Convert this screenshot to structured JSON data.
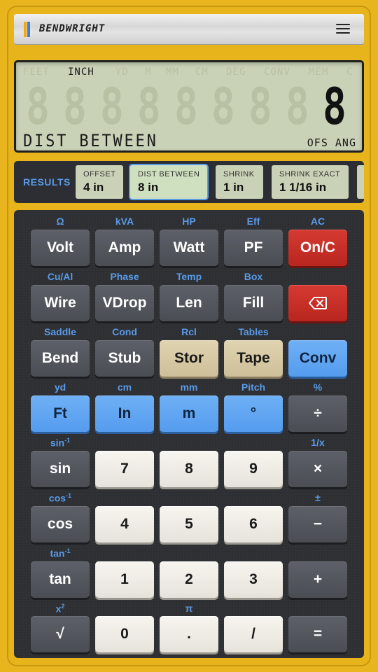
{
  "brand": {
    "name": "BENDWRIGHT",
    "menu_icon": "hamburger-menu-icon"
  },
  "lcd": {
    "annunciators": [
      {
        "label": "FEET",
        "on": false
      },
      {
        "label": "INCH",
        "on": true
      },
      {
        "label": "YD",
        "on": false
      },
      {
        "label": "M",
        "on": false
      },
      {
        "label": "MM",
        "on": false
      },
      {
        "label": "CM",
        "on": false
      },
      {
        "label": "DEG",
        "on": false
      },
      {
        "label": "CONV",
        "on": false
      },
      {
        "label": "MEM",
        "on": false
      },
      {
        "label": "C",
        "on": false
      }
    ],
    "ghost_digits": [
      "8",
      "8",
      "8",
      "8",
      "8",
      "8",
      "8",
      "8",
      "8"
    ],
    "value": "8",
    "label": "DIST BETWEEN",
    "mode": "OFS ANG"
  },
  "results": {
    "label": "RESULTS",
    "chips": [
      {
        "title": "OFFSET",
        "value": "4 in",
        "selected": false
      },
      {
        "title": "DIST BETWEEN",
        "value": "8 in",
        "selected": true
      },
      {
        "title": "SHRINK",
        "value": "1 in",
        "selected": false
      },
      {
        "title": "SHRINK EXACT",
        "value": "1 1/16 in",
        "selected": false
      }
    ]
  },
  "keys": {
    "volt": {
      "label": "Volt",
      "sec": "Ω"
    },
    "amp": {
      "label": "Amp",
      "sec": "kVA"
    },
    "watt": {
      "label": "Watt",
      "sec": "HP"
    },
    "pf": {
      "label": "PF",
      "sec": "Eff"
    },
    "on_c": {
      "label": "On/C",
      "sec": "AC"
    },
    "wire": {
      "label": "Wire",
      "sec": "Cu/Al"
    },
    "vdrop": {
      "label": "VDrop",
      "sec": "Phase"
    },
    "len": {
      "label": "Len",
      "sec": "Temp"
    },
    "fill": {
      "label": "Fill",
      "sec": "Box"
    },
    "backspace": {
      "icon": "backspace-icon"
    },
    "bend": {
      "label": "Bend",
      "sec": "Saddle"
    },
    "stub": {
      "label": "Stub",
      "sec": "Cond"
    },
    "stor": {
      "label": "Stor",
      "sec": "Rcl"
    },
    "tape": {
      "label": "Tape",
      "sec": "Tables"
    },
    "conv": {
      "label": "Conv"
    },
    "ft": {
      "label": "Ft",
      "sec": "yd"
    },
    "in": {
      "label": "In",
      "sec": "cm"
    },
    "m": {
      "label": "m",
      "sec": "mm"
    },
    "deg": {
      "label": "°",
      "sec": "Pitch"
    },
    "div": {
      "label": "÷",
      "sec": "%"
    },
    "sin": {
      "label": "sin",
      "sec": "sin",
      "sec_sup": "-1"
    },
    "k7": {
      "label": "7"
    },
    "k8": {
      "label": "8"
    },
    "k9": {
      "label": "9"
    },
    "mul": {
      "label": "×",
      "sec": "1/x"
    },
    "cos": {
      "label": "cos",
      "sec": "cos",
      "sec_sup": "-1"
    },
    "k4": {
      "label": "4"
    },
    "k5": {
      "label": "5"
    },
    "k6": {
      "label": "6"
    },
    "sub": {
      "label": "−",
      "sec": "±"
    },
    "tan": {
      "label": "tan",
      "sec": "tan",
      "sec_sup": "-1"
    },
    "k1": {
      "label": "1"
    },
    "k2": {
      "label": "2"
    },
    "k3": {
      "label": "3"
    },
    "add": {
      "label": "+"
    },
    "sqrt": {
      "label": "√",
      "sec": "x",
      "sec_sup": "2"
    },
    "k0": {
      "label": "0"
    },
    "dot": {
      "label": ".",
      "sec": "π"
    },
    "frac": {
      "label": "/"
    },
    "eq": {
      "label": "="
    }
  }
}
